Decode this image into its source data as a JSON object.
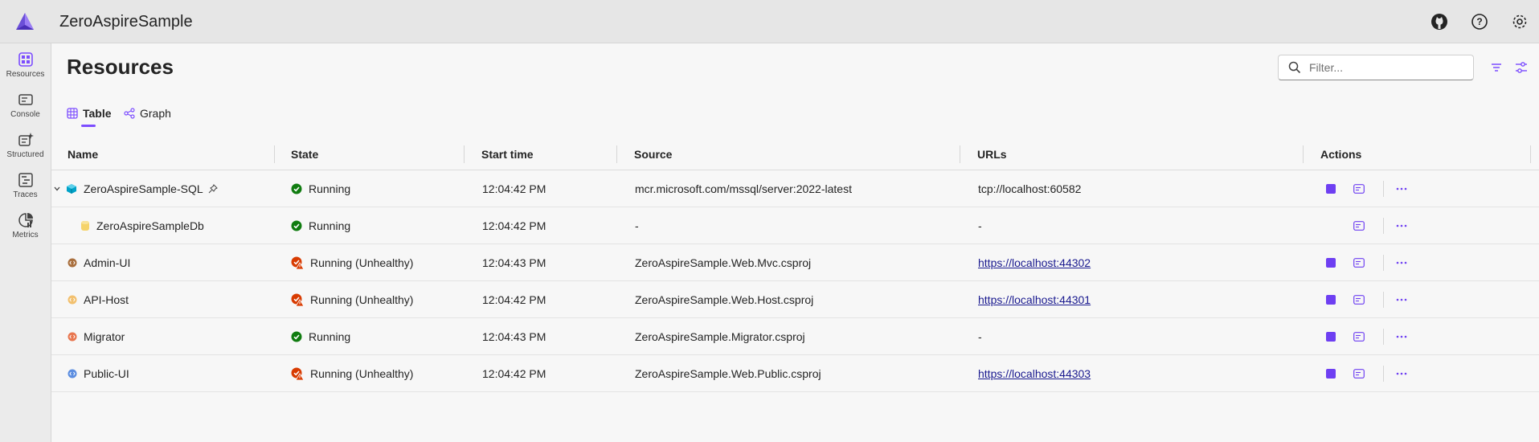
{
  "app": {
    "title": "ZeroAspireSample"
  },
  "sidebar": {
    "items": [
      {
        "label": "Resources",
        "icon": "resources-icon",
        "active": true
      },
      {
        "label": "Console",
        "icon": "console-icon"
      },
      {
        "label": "Structured",
        "icon": "structured-icon"
      },
      {
        "label": "Traces",
        "icon": "traces-icon"
      },
      {
        "label": "Metrics",
        "icon": "metrics-icon"
      }
    ]
  },
  "page": {
    "title": "Resources",
    "filter_placeholder": "Filter...",
    "tabs": [
      {
        "label": "Table",
        "active": true
      },
      {
        "label": "Graph",
        "active": false
      }
    ]
  },
  "table": {
    "columns": [
      "Name",
      "State",
      "Start time",
      "Source",
      "URLs",
      "Actions"
    ],
    "rows": [
      {
        "name": "ZeroAspireSample-SQL",
        "icon": "container-icon",
        "state": "Running",
        "health": "ok",
        "start_time": "12:04:42 PM",
        "source": "mcr.microsoft.com/mssql/server:2022-latest",
        "url": "tcp://localhost:60582",
        "url_link": false,
        "stop": true
      },
      {
        "name": "ZeroAspireSampleDb",
        "icon": "database-icon",
        "state": "Running",
        "health": "ok",
        "start_time": "12:04:42 PM",
        "source": "-",
        "url": "-",
        "url_link": false,
        "stop": false
      },
      {
        "name": "Admin-UI",
        "icon": "project-icon",
        "state": "Running (Unhealthy)",
        "health": "unhealthy",
        "start_time": "12:04:43 PM",
        "source": "ZeroAspireSample.Web.Mvc.csproj",
        "url": "https://localhost:44302",
        "url_link": true,
        "stop": true
      },
      {
        "name": "API-Host",
        "icon": "project-icon",
        "state": "Running (Unhealthy)",
        "health": "unhealthy",
        "start_time": "12:04:42 PM",
        "source": "ZeroAspireSample.Web.Host.csproj",
        "url": "https://localhost:44301",
        "url_link": true,
        "stop": true
      },
      {
        "name": "Migrator",
        "icon": "project-icon",
        "state": "Running",
        "health": "ok",
        "start_time": "12:04:43 PM",
        "source": "ZeroAspireSample.Migrator.csproj",
        "url": "-",
        "url_link": false,
        "stop": true
      },
      {
        "name": "Public-UI",
        "icon": "project-icon",
        "state": "Running (Unhealthy)",
        "health": "unhealthy",
        "start_time": "12:04:42 PM",
        "source": "ZeroAspireSample.Web.Public.csproj",
        "url": "https://localhost:44303",
        "url_link": true,
        "stop": true
      }
    ]
  },
  "colors": {
    "accent": "#7c4dff",
    "running": "#107c10",
    "unhealthy": "#d83b01",
    "link": "#1a1a8f"
  }
}
